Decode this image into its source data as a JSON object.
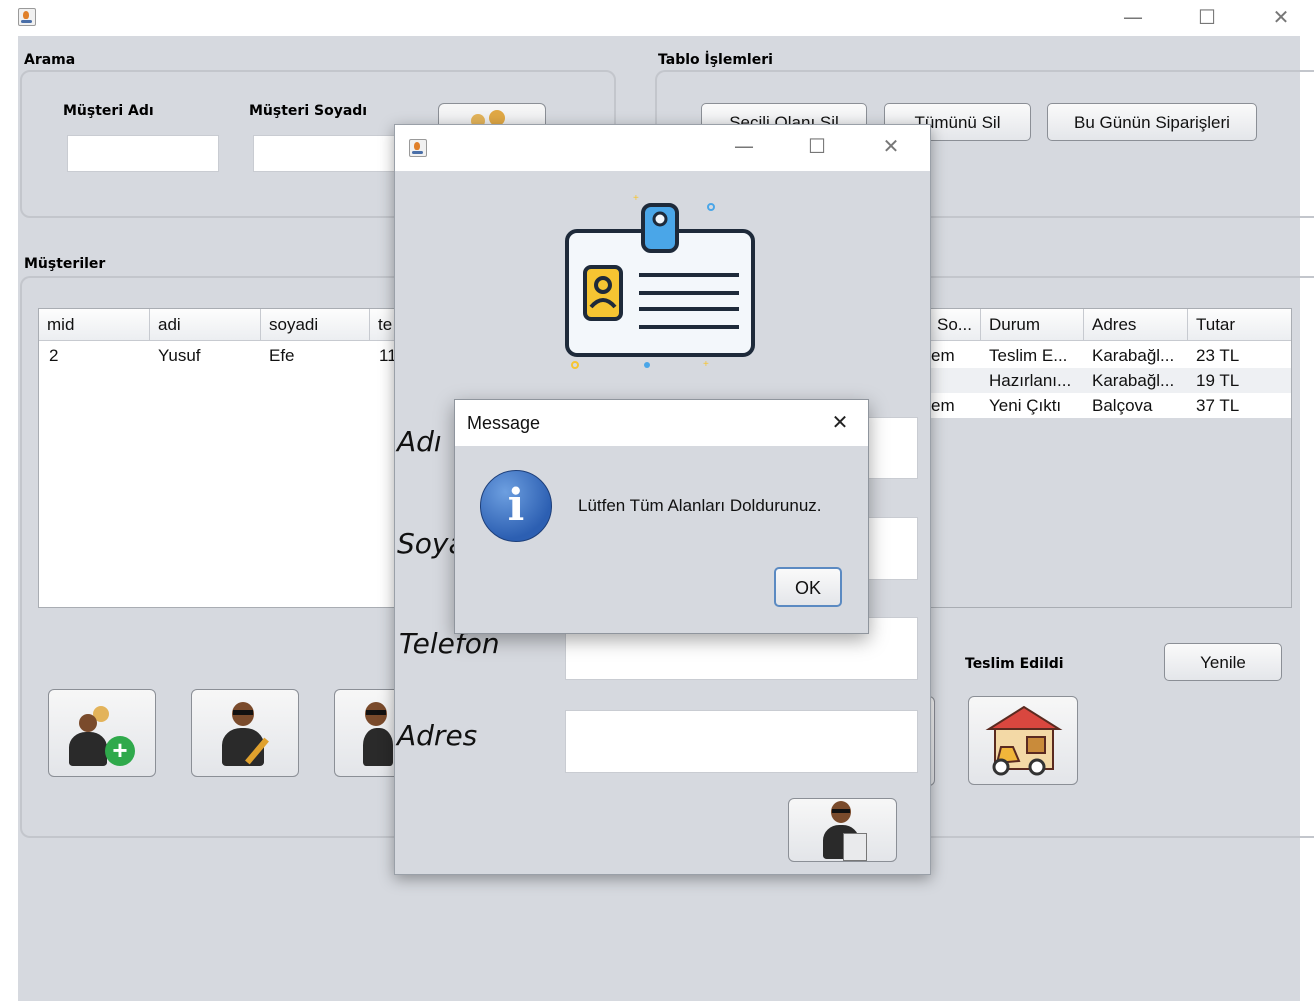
{
  "main_window": {
    "icon": "java-app-icon",
    "controls": {
      "minimize": "—",
      "maximize": "☐",
      "close": "✕"
    }
  },
  "search": {
    "title": "Arama",
    "first_name_label": "Müşteri Adı",
    "last_name_label": "Müşteri Soyadı",
    "first_name_value": "",
    "last_name_value": "",
    "search_button_icon": "search-customers-icon"
  },
  "table_ops": {
    "title": "Tablo İşlemleri",
    "delete_selected_label": "Seçili Olanı Sil",
    "delete_all_label": "Tümünü Sil",
    "todays_orders_label": "Bu Günün Siparişleri"
  },
  "customers": {
    "title": "Müşteriler",
    "columns": [
      "mid",
      "adi",
      "soyadi",
      "te"
    ],
    "rows": [
      {
        "mid": "2",
        "adi": "Yusuf",
        "soyadi": "Efe",
        "te": "11"
      }
    ],
    "add_button_icon": "add-customer-icon",
    "edit_button_icon": "edit-customer-icon",
    "delete_button_icon": "delete-customer-icon"
  },
  "orders": {
    "columns": [
      "So...",
      "Durum",
      "Adres",
      "Tutar"
    ],
    "rows": [
      {
        "so": "em",
        "durum": "Teslim E...",
        "adres": "Karabağl...",
        "tutar": "23 TL"
      },
      {
        "so": "",
        "durum": "Hazırlanı...",
        "adres": "Karabağl...",
        "tutar": "19 TL"
      },
      {
        "so": "em",
        "durum": "Yeni Çıktı",
        "adres": "Balçova",
        "tutar": "37 TL"
      }
    ],
    "delivered_label": "Teslim Edildi",
    "refresh_label": "Yenile",
    "delivered_button_icon": "delivery-scooter-icon"
  },
  "customer_dialog": {
    "icon": "java-app-icon",
    "controls": {
      "minimize": "—",
      "maximize": "☐",
      "close": "✕"
    },
    "header_icon": "id-card-icon",
    "name_label": "Adı",
    "surname_label": "Soya",
    "phone_label": "Telefon",
    "address_label": "Adres",
    "name_value": "",
    "surname_value": "",
    "phone_value": "",
    "address_value": "",
    "save_button_icon": "save-customer-icon"
  },
  "message_box": {
    "title": "Message",
    "close": "✕",
    "text": "Lütfen Tüm Alanları Doldurunuz.",
    "ok_label": "OK",
    "icon": "information-icon",
    "icon_glyph": "i"
  }
}
